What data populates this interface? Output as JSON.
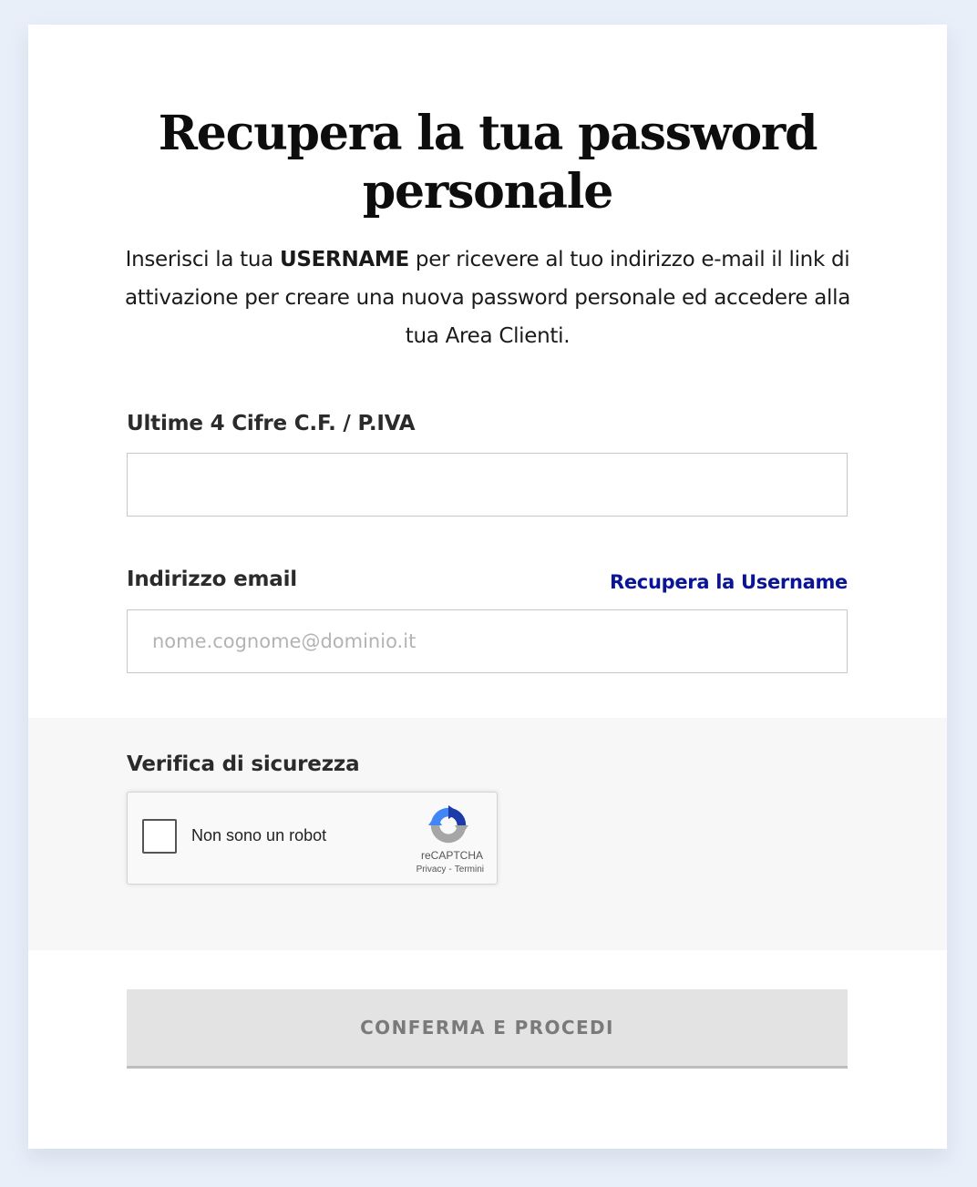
{
  "header": {
    "title": "Recupera la tua password personale",
    "intro_before": "Inserisci la tua ",
    "intro_bold": "USERNAME",
    "intro_after": " per ricevere al tuo indirizzo e-mail il link di attivazione per creare una nuova password personale ed accedere alla tua Area Clienti."
  },
  "form": {
    "cf_label": "Ultime 4 Cifre C.F. / P.IVA",
    "cf_value": "",
    "email_label": "Indirizzo email",
    "email_placeholder": "nome.cognome@dominio.it",
    "email_value": "",
    "recover_username_link": "Recupera la Username"
  },
  "security": {
    "label": "Verifica di sicurezza",
    "captcha_checkbox_label": "Non sono un robot",
    "captcha_checked": false,
    "captcha_brand": "reCAPTCHA",
    "captcha_privacy": "Privacy",
    "captcha_separator": "-",
    "captcha_terms": "Termini",
    "captcha_icon": "recaptcha-logo-icon"
  },
  "actions": {
    "submit_label": "CONFERMA E PROCEDI",
    "submit_enabled": false
  },
  "colors": {
    "page_background": "#e8eff9",
    "card_background": "#ffffff",
    "link": "#0a1496",
    "security_background": "#f7f7f7",
    "button_disabled": "#e3e3e3",
    "button_text_disabled": "#7a7a7a"
  }
}
